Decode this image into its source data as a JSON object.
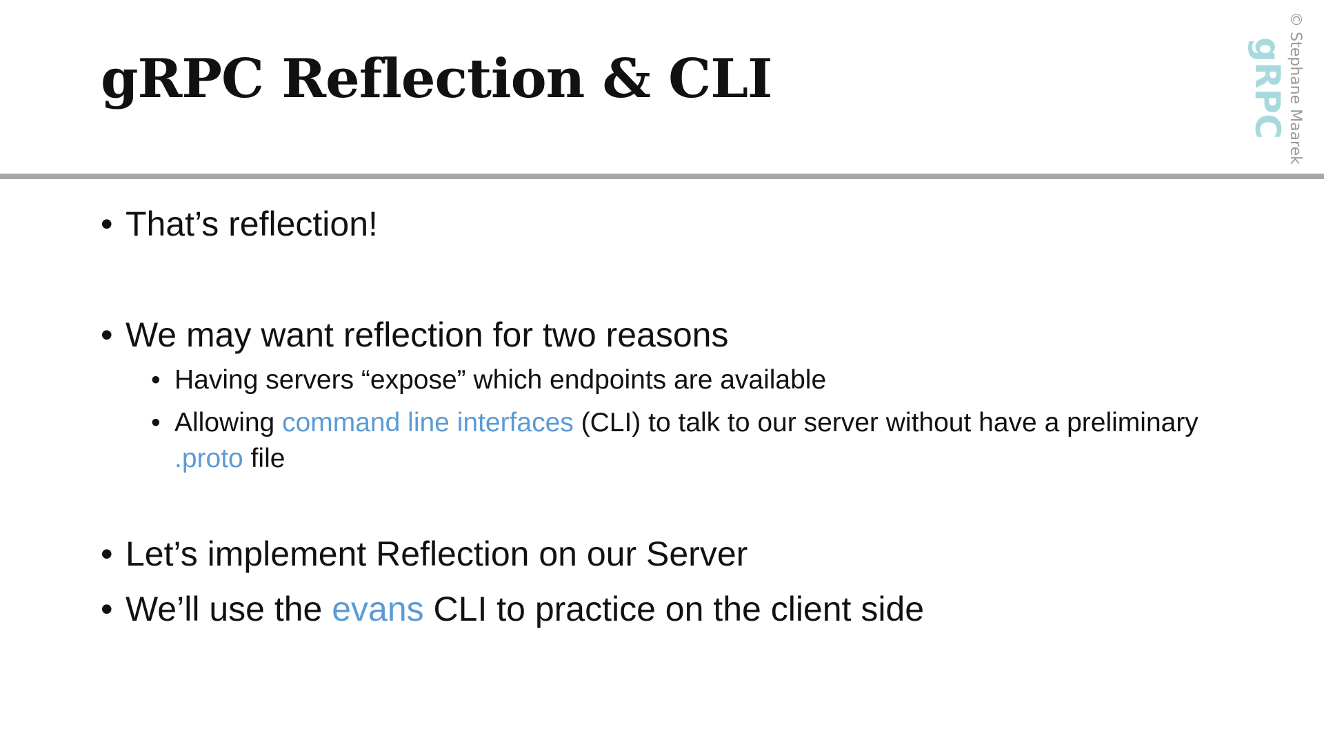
{
  "slide": {
    "title": "gRPC Reflection & CLI",
    "logo_text": "gRPC",
    "copyright": "© Stephane Maarek"
  },
  "bullets": {
    "marker": "•",
    "b1": "That’s reflection!",
    "b2": "We may want reflection for two reasons",
    "b2_sub1": "Having servers “expose” which endpoints are available",
    "b2_sub2": {
      "part1": "Allowing ",
      "link1": "command line interfaces",
      "part2": " (CLI) to talk to our server without have a preliminary ",
      "link2": ".proto",
      "part3": " file"
    },
    "b3": "Let’s implement Reflection on our Server",
    "b4": {
      "part1": "We’ll use the ",
      "link": "evans",
      "part2": " CLI to practice on the client side"
    }
  },
  "colors": {
    "highlight": "#5b9bd5",
    "divider": "#a6a6a6",
    "logo": "#a8d9dc",
    "copyright": "#9a9a9a"
  }
}
